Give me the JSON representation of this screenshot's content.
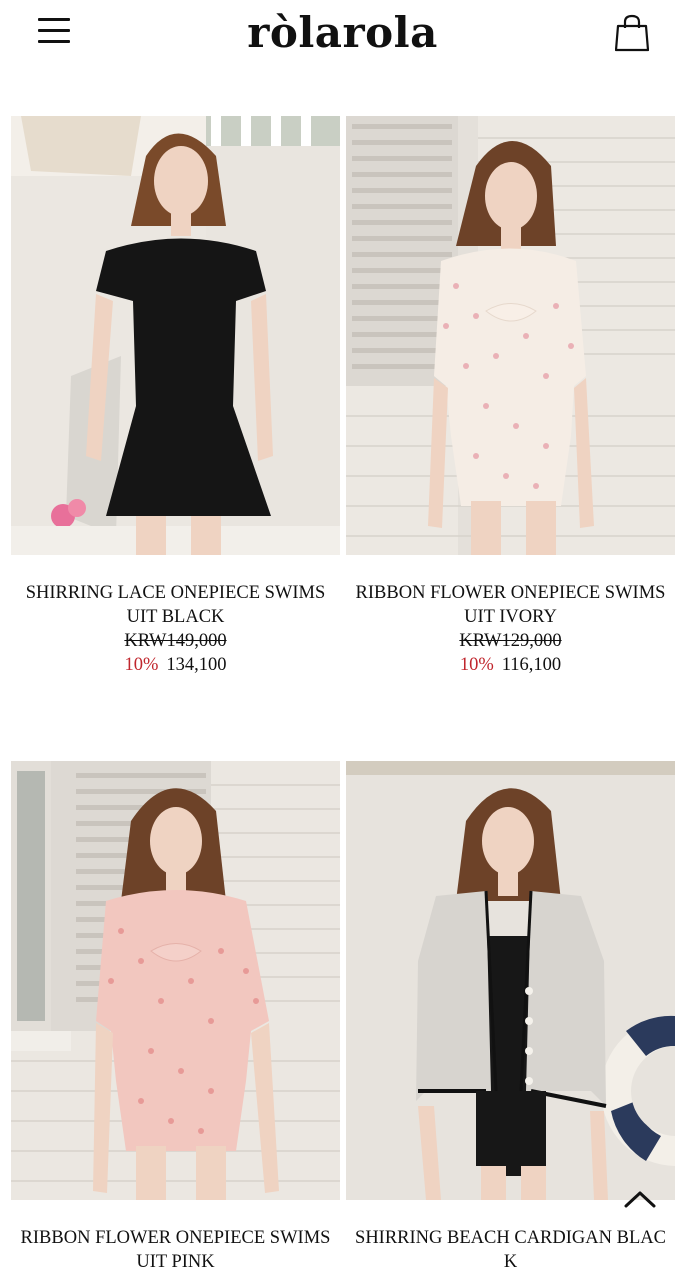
{
  "header": {
    "logo": "ròlarola"
  },
  "products": [
    {
      "name": "SHIRRING LACE ONEPIECE SWIMS UIT BLACK",
      "original_price": "KRW149,000",
      "discount": "10%",
      "sale_price": "134,100"
    },
    {
      "name": "RIBBON FLOWER ONEPIECE SWIMS UIT IVORY",
      "original_price": "KRW129,000",
      "discount": "10%",
      "sale_price": "116,100"
    },
    {
      "name": "RIBBON FLOWER ONEPIECE SWIMS UIT PINK"
    },
    {
      "name": "SHIRRING BEACH CARDIGAN BLAC K"
    }
  ],
  "colors": {
    "discount": "#c0262d",
    "text": "#111111"
  }
}
